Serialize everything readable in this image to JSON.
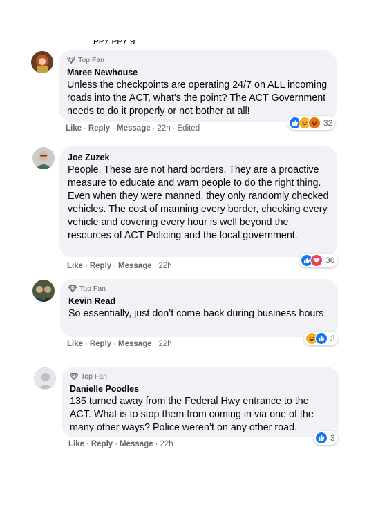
{
  "comments": [
    {
      "badge": "Top Fan",
      "author": "Maree Newhouse",
      "text": "Unless the checkpoints are operating 24/7 on ALL incoming roads into the ACT, what's the point? The ACT Government needs to do it properly or not bother at all!",
      "actions": {
        "like": "Like",
        "reply": "Reply",
        "message": "Message",
        "time": "22h",
        "edited": "Edited"
      },
      "reaction_count": "32",
      "reactions": [
        "like-icon",
        "haha-icon",
        "angry-icon"
      ]
    },
    {
      "author": "Joe Zuzek",
      "text": "People. These are not hard borders. They are a proactive measure to educate and warn people to do the right thing. Even when they were manned, they only randomly checked vehicles. The cost of manning every border, checking every vehicle and covering every hour is well beyond the resources of ACT Policing and the local government.",
      "actions": {
        "like": "Like",
        "reply": "Reply",
        "message": "Message",
        "time": "22h"
      },
      "reaction_count": "36",
      "reactions": [
        "like-icon",
        "love-icon"
      ]
    },
    {
      "badge": "Top Fan",
      "author": "Kevin Read",
      "text": "So essentially, just don’t come back during business hours",
      "actions": {
        "like": "Like",
        "reply": "Reply",
        "message": "Message",
        "time": "22h"
      },
      "reaction_count": "3",
      "reactions": [
        "haha-icon",
        "like-icon"
      ]
    },
    {
      "badge": "Top Fan",
      "author": "Danielle Poodles",
      "text": "135 turned away from the Federal Hwy entrance to the ACT. What is to stop them from coming in via one of the many other ways? Police weren’t on any other road.",
      "actions": {
        "like": "Like",
        "reply": "Reply",
        "message": "Message",
        "time": "22h"
      },
      "reaction_count": "3",
      "reactions": [
        "like-icon"
      ]
    }
  ],
  "colors": {
    "bubble": "#f0f2f5",
    "meta": "#65676b",
    "like": "#1877f2",
    "love": "#f33e58",
    "haha": "#f7b125",
    "angry": "#e9710f"
  }
}
